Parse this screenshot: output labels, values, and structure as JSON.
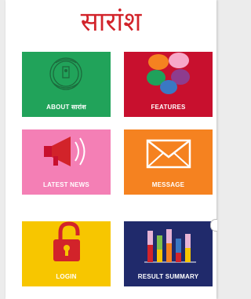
{
  "app": {
    "title": "सारांश"
  },
  "tiles": [
    {
      "label": "ABOUT सारांश",
      "color": "#21a35a",
      "icon": "emblem-icon"
    },
    {
      "label": "FEATURES",
      "color": "#c8102e",
      "icon": "petals-icon"
    },
    {
      "label": "LATEST NEWS",
      "color": "#f47fb5",
      "icon": "megaphone-icon"
    },
    {
      "label": "MESSAGE",
      "color": "#f58220",
      "icon": "envelope-icon"
    },
    {
      "label": "LOGIN",
      "color": "#f7c600",
      "icon": "padlock-icon"
    },
    {
      "label": "RESULT SUMMARY",
      "color": "#202a6b",
      "icon": "bar-chart-icon"
    }
  ]
}
